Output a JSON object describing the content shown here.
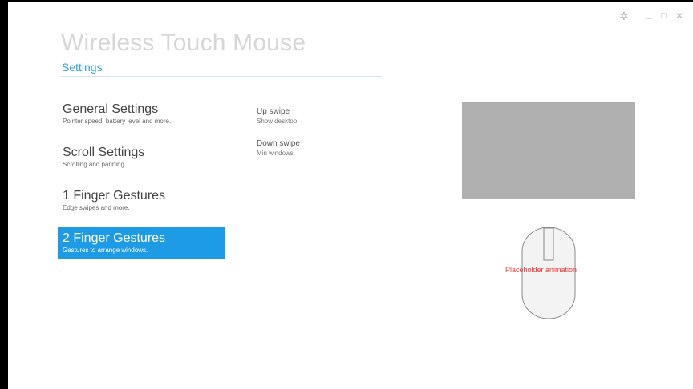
{
  "header": {
    "app_title": "Wireless Touch Mouse",
    "breadcrumb": "Settings"
  },
  "window_controls": {
    "settings_glyph": "✲",
    "minimize_glyph": "_",
    "maximize_glyph": "□",
    "close_glyph": "✕"
  },
  "nav": {
    "items": [
      {
        "label": "General Settings",
        "desc": "Pointer speed, battery level and more."
      },
      {
        "label": "Scroll Settings",
        "desc": "Scrolling and panning."
      },
      {
        "label": "1 Finger Gestures",
        "desc": "Edge swipes and more."
      },
      {
        "label": "2 Finger Gestures",
        "desc": "Gestures to arrange windows."
      }
    ],
    "selected_index": 3
  },
  "gestures": [
    {
      "label": "Up swipe",
      "value": "Show desktop"
    },
    {
      "label": "Down swipe",
      "value": "Min windows"
    }
  ],
  "preview": {
    "animation_placeholder": "Placeholder animation"
  },
  "colors": {
    "accent": "#1e9be5",
    "breadcrumb": "#33a0d8",
    "preview_gray": "#b0b0b0",
    "placeholder_red": "#e53935"
  },
  "icons": [
    "gear-icon",
    "minimize-icon",
    "maximize-icon",
    "close-icon",
    "mouse-icon"
  ]
}
